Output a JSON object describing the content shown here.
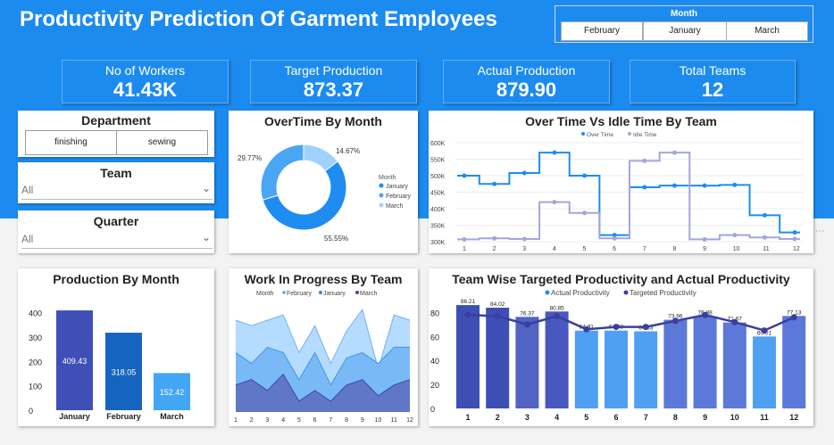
{
  "title": "Productivity Prediction Of Garment Employees",
  "month_slicer": {
    "label": "Month",
    "options": [
      "February",
      "January",
      "March"
    ]
  },
  "kpis": [
    {
      "label": "No of Workers",
      "value": "41.43K"
    },
    {
      "label": "Target Production",
      "value": "873.37"
    },
    {
      "label": "Actual Production",
      "value": "879.90"
    },
    {
      "label": "Total Teams",
      "value": "12"
    }
  ],
  "department": {
    "title": "Department",
    "options": [
      "finishing",
      "sewing"
    ]
  },
  "team": {
    "title": "Team",
    "value": "All"
  },
  "quarter": {
    "title": "Quarter",
    "value": "All"
  },
  "colors": {
    "band": "#1C8BF0",
    "january": "#1E8CF0",
    "february": "#3F51B5",
    "march": "#9FD2FF",
    "navy": "#3A3F9E",
    "idle": "#A3A6DB"
  },
  "chart_data": [
    {
      "type": "pie",
      "title": "OverTime By Month",
      "donut": true,
      "legend_title": "Month",
      "legend": [
        "January",
        "February",
        "March"
      ],
      "slices": [
        {
          "name": "January",
          "pct": 55.55,
          "label": "55.55%"
        },
        {
          "name": "February",
          "pct": 29.77,
          "label": "29.77%"
        },
        {
          "name": "March",
          "pct": 14.67,
          "label": "14.67%"
        }
      ]
    },
    {
      "type": "line",
      "title": "Over Time Vs Idle Time By Team",
      "step": true,
      "x": [
        1,
        2,
        3,
        4,
        5,
        6,
        7,
        8,
        9,
        10,
        11,
        12
      ],
      "series": [
        {
          "name": "Over Time",
          "values": [
            500000,
            475000,
            508000,
            570000,
            500000,
            320000,
            465000,
            470000,
            470000,
            472000,
            380000,
            328000
          ]
        },
        {
          "name": "Idle Time",
          "values": [
            307000,
            310000,
            308000,
            420000,
            387000,
            310000,
            545000,
            570000,
            307000,
            320000,
            313000,
            308000
          ]
        }
      ],
      "yticks": [
        "300K",
        "350K",
        "400K",
        "450K",
        "500K",
        "550K",
        "600K"
      ],
      "ylim": [
        300000,
        600000
      ]
    },
    {
      "type": "bar",
      "title": "Production By Month",
      "categories": [
        "January",
        "February",
        "March"
      ],
      "values": [
        409.43,
        318.05,
        152.42
      ],
      "labels": [
        "409.43",
        "318.05",
        "152.42"
      ],
      "yticks": [
        "0",
        "100",
        "200",
        "300",
        "400"
      ],
      "ylim": [
        0,
        450
      ]
    },
    {
      "type": "area",
      "title": "Work In Progress By Team",
      "legend_title": "Month",
      "legend": [
        "February",
        "January",
        "March"
      ],
      "x": [
        1,
        2,
        3,
        4,
        5,
        6,
        7,
        8,
        9,
        10,
        11,
        12
      ],
      "series": [
        {
          "name": "February",
          "values": [
            85,
            80,
            85,
            90,
            55,
            80,
            45,
            75,
            95,
            40,
            90,
            85
          ]
        },
        {
          "name": "January",
          "values": [
            55,
            45,
            60,
            55,
            30,
            55,
            25,
            50,
            55,
            45,
            60,
            60
          ]
        },
        {
          "name": "March",
          "values": [
            25,
            30,
            20,
            35,
            10,
            20,
            10,
            25,
            30,
            15,
            25,
            30
          ]
        }
      ]
    },
    {
      "type": "bar",
      "title": "Team Wise Targeted Productivity and Actual Productivity",
      "legend": [
        "Actual Productivity",
        "Targeted Productivity"
      ],
      "categories": [
        "1",
        "2",
        "3",
        "4",
        "5",
        "6",
        "7",
        "8",
        "9",
        "10",
        "11",
        "12"
      ],
      "series": [
        {
          "name": "Actual Productivity",
          "values": [
            86.21,
            84.02,
            76.37,
            80.85,
            64.91,
            64.93,
            64.33,
            73.96,
            76.88,
            71.67,
            60.01,
            77.13
          ],
          "labels": [
            "86.21",
            "84.02",
            "76.37",
            "80.85",
            "64.91",
            "64.93",
            "64.33",
            "73.96",
            "76.88",
            "71.67",
            "60.01",
            "77.13"
          ]
        },
        {
          "name": "Targeted Productivity",
          "values": [
            78,
            77,
            70,
            77,
            66,
            68,
            68,
            73,
            78,
            72,
            65,
            76
          ]
        }
      ],
      "yticks": [
        "0",
        "20",
        "40",
        "60",
        "80"
      ],
      "ylim": [
        0,
        90
      ]
    }
  ]
}
